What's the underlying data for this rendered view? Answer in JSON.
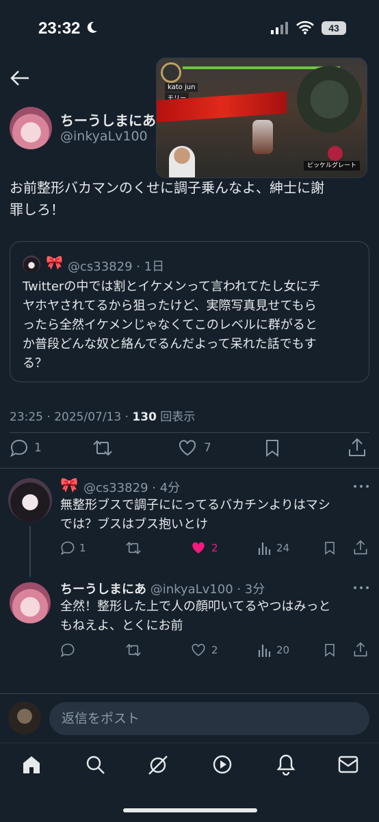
{
  "status": {
    "time": "23:32",
    "battery": "43"
  },
  "post": {
    "author_name": "ちーうしまにあ",
    "author_handle": "@inkyaLv100",
    "text_line1": "お前整形バカマンのくせに調子乗んなよ、紳士に謝",
    "text_line2": "罪しろ！",
    "video": {
      "player_label": "kato jun",
      "partner_label": "モリー",
      "item_label": "ピッケルグレート"
    },
    "timestamp": "23:25 · 2025/07/13 · ",
    "views_count": "130",
    "views_label": " 回表示",
    "reply_count": "1",
    "like_count": "7"
  },
  "quoted": {
    "handle_time": "@cs33829 · 1日",
    "lines": [
      "Twitterの中では割とイケメンって言われてたし女にチ",
      "ヤホヤされてるから狙ったけど、実際写真見せてもら",
      "ったら全然イケメンじゃなくてこのレベルに群がると",
      "か普段どんな奴と絡んでるんだよって呆れた話でもす",
      "る？"
    ]
  },
  "replies": [
    {
      "name": "",
      "handle_time": "@cs33829 · 4分",
      "line1": "無整形ブスで調子ににってるバカチンよりはマシ",
      "line2": "では？ブスはブス抱いとけ",
      "reply_count": "1",
      "like_count": "2",
      "view_count": "24",
      "liked": true
    },
    {
      "name": "ちーうしまにあ",
      "handle_time": "@inkyaLv100 · 3分",
      "line1": "全然！整形した上で人の顔叩いてるやつはみっと",
      "line2": "もねえよ、とくにお前",
      "reply_count": "",
      "like_count": "2",
      "view_count": "20",
      "liked": false
    }
  ],
  "composer": {
    "placeholder": "返信をポスト"
  },
  "colors": {
    "background": "#15202b",
    "like_active": "#f91880",
    "muted": "#8b98a5"
  },
  "nav_icons": [
    "home-icon",
    "search-icon",
    "grok-icon",
    "video-icon",
    "notifications-icon",
    "messages-icon"
  ]
}
